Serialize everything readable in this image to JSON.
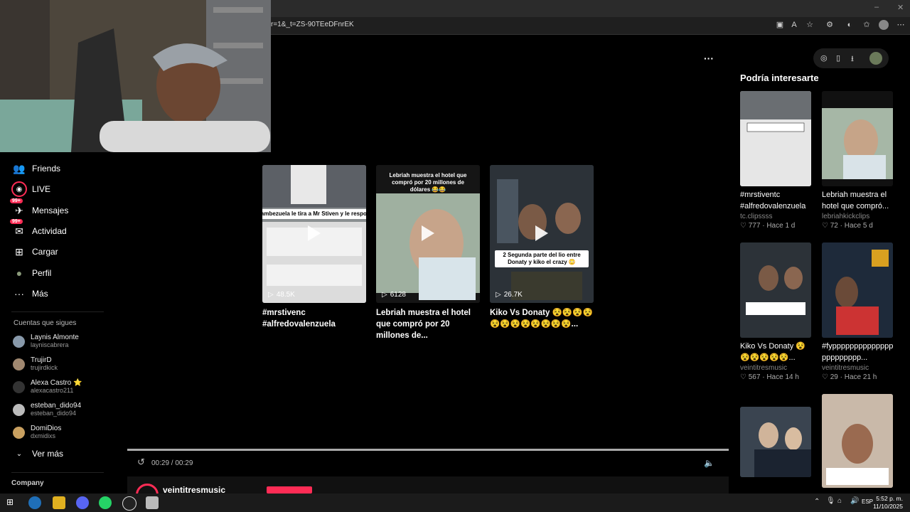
{
  "browser": {
    "url": "r=1&_t=ZS-90TEeDFnrEK",
    "window_controls": [
      "–",
      "❐",
      "✕"
    ]
  },
  "sidebar": {
    "items": [
      {
        "label": "Friends",
        "icon": "friends-icon",
        "glyph": "👥"
      },
      {
        "label": "LIVE",
        "icon": "live-icon",
        "glyph": "◉"
      },
      {
        "label": "Mensajes",
        "icon": "messages-icon",
        "glyph": "✈",
        "badge": "99+"
      },
      {
        "label": "Actividad",
        "icon": "activity-icon",
        "glyph": "✉",
        "badge": "99+"
      },
      {
        "label": "Cargar",
        "icon": "upload-icon",
        "glyph": "⊞"
      },
      {
        "label": "Perfil",
        "icon": "profile-icon",
        "glyph": "●"
      },
      {
        "label": "Más",
        "icon": "more-icon",
        "glyph": "···"
      }
    ],
    "following_header": "Cuentas que sigues",
    "following": [
      {
        "name": "Laynis Almonte",
        "user": "layniscabrera"
      },
      {
        "name": "TrujirD",
        "user": "trujirdkick"
      },
      {
        "name": "Alexa Castro ⭐",
        "user": "alexacastro211"
      },
      {
        "name": "esteban_dido94",
        "user": "esteban_dido94"
      },
      {
        "name": "DomiDios",
        "user": "dxmidixs"
      }
    ],
    "see_more": "Ver más",
    "company": "Company"
  },
  "videos": [
    {
      "title": "#mrstivenc #alfredovalenzuela",
      "views": "48.5K",
      "caption": "Alfredo Lambezuela le tira a Mr Stiven y le responde 😡🩸"
    },
    {
      "title": "Lebriah muestra el hotel que compró por 20 millones de...",
      "views": "6128",
      "caption": "Lebriah muestra el hotel que compró por 20 millones de dólares 😂😂"
    },
    {
      "title": "Kiko Vs Donaty 😵😵😵😵 😵😵😵😵😵😵😵😵...",
      "views": "26.7K",
      "caption": "2 Segunda parte del lio entre Donaty y kiko el crazy 😳"
    }
  ],
  "player": {
    "time": "00:29 / 00:29",
    "more_label": "···",
    "progress": 1.0,
    "author_partial": "veintitresmusic"
  },
  "recommend": {
    "header": "Podría interesarte",
    "items": [
      {
        "title": "#mrstiventc #alfredovalenzuela",
        "author": "tc.clipssss",
        "likes": "777",
        "age": "Hace 1 d"
      },
      {
        "title": "Lebriah muestra el hotel que compró...",
        "author": "lebriahkickclips",
        "likes": "72",
        "age": "Hace 5 d"
      },
      {
        "title": "Kiko Vs Donaty 😵 😵😵😵😵😵...",
        "author": "veintitresmusic",
        "likes": "567",
        "age": "Hace 14 h"
      },
      {
        "title": "#fypppppppppppppp ppppppppp...",
        "author": "veintitresmusic",
        "likes": "29",
        "age": "Hace 21 h"
      }
    ]
  },
  "taskbar": {
    "lang": "ESP",
    "time": "5:52 p. m.",
    "date": "11/10/2025"
  },
  "colors": {
    "accent": "#fe2c55",
    "bg": "#000000"
  }
}
